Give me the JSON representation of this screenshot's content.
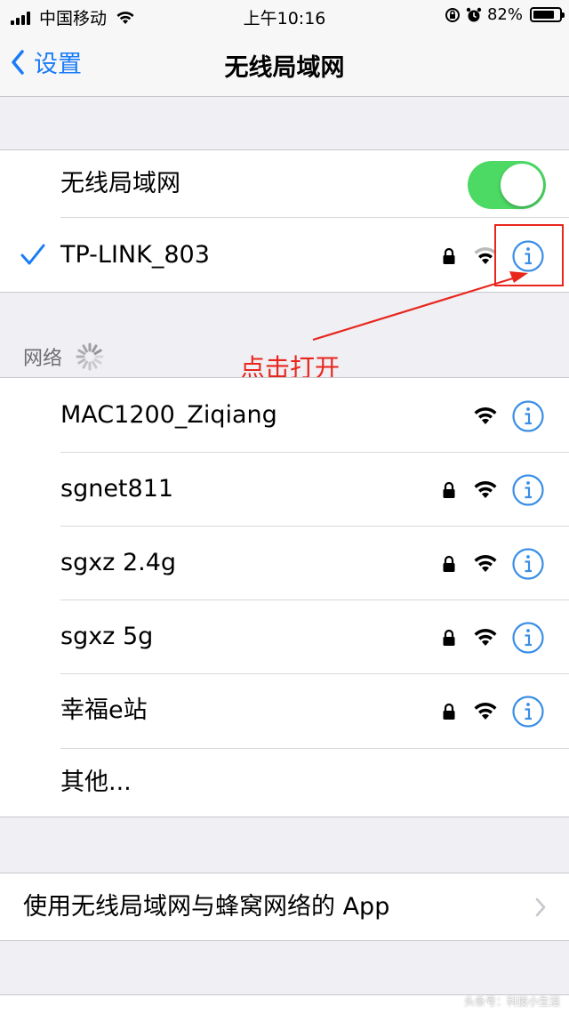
{
  "status_bar": {
    "carrier": "中国移动",
    "time": "上午10:16",
    "battery": "82%",
    "battery_level": 0.82
  },
  "nav": {
    "back_label": "设置",
    "title": "无线局域网"
  },
  "wifi_toggle": {
    "label": "无线局域网",
    "on": true
  },
  "connected": {
    "name": "TP-LINK_803",
    "secured": true
  },
  "networks_header": "网络",
  "networks": [
    {
      "name": "MAC1200_Ziqiang",
      "secured": false
    },
    {
      "name": "sgnet811",
      "secured": true
    },
    {
      "name": "sgxz 2.4g",
      "secured": true
    },
    {
      "name": "sgxz 5g",
      "secured": true
    },
    {
      "name": "幸福e站",
      "secured": true
    }
  ],
  "other_label": "其他...",
  "apps_row": {
    "label": "使用无线局域网与蜂窝网络的 App"
  },
  "annotation": {
    "text": "点击打开",
    "color": "#e8261c"
  },
  "colors": {
    "accent": "#1a7cf6",
    "toggle_on": "#4cd964",
    "info": "#3a8ee6"
  },
  "icons": {
    "wifi": "wifi-signal-icon",
    "lock": "lock-icon",
    "info": "info-circle-icon",
    "check": "checkmark-icon",
    "chevron": "chevron-right-icon",
    "back": "chevron-left-icon",
    "spinner": "loading-spinner-icon"
  },
  "watermark": "头条号：科技小生活"
}
